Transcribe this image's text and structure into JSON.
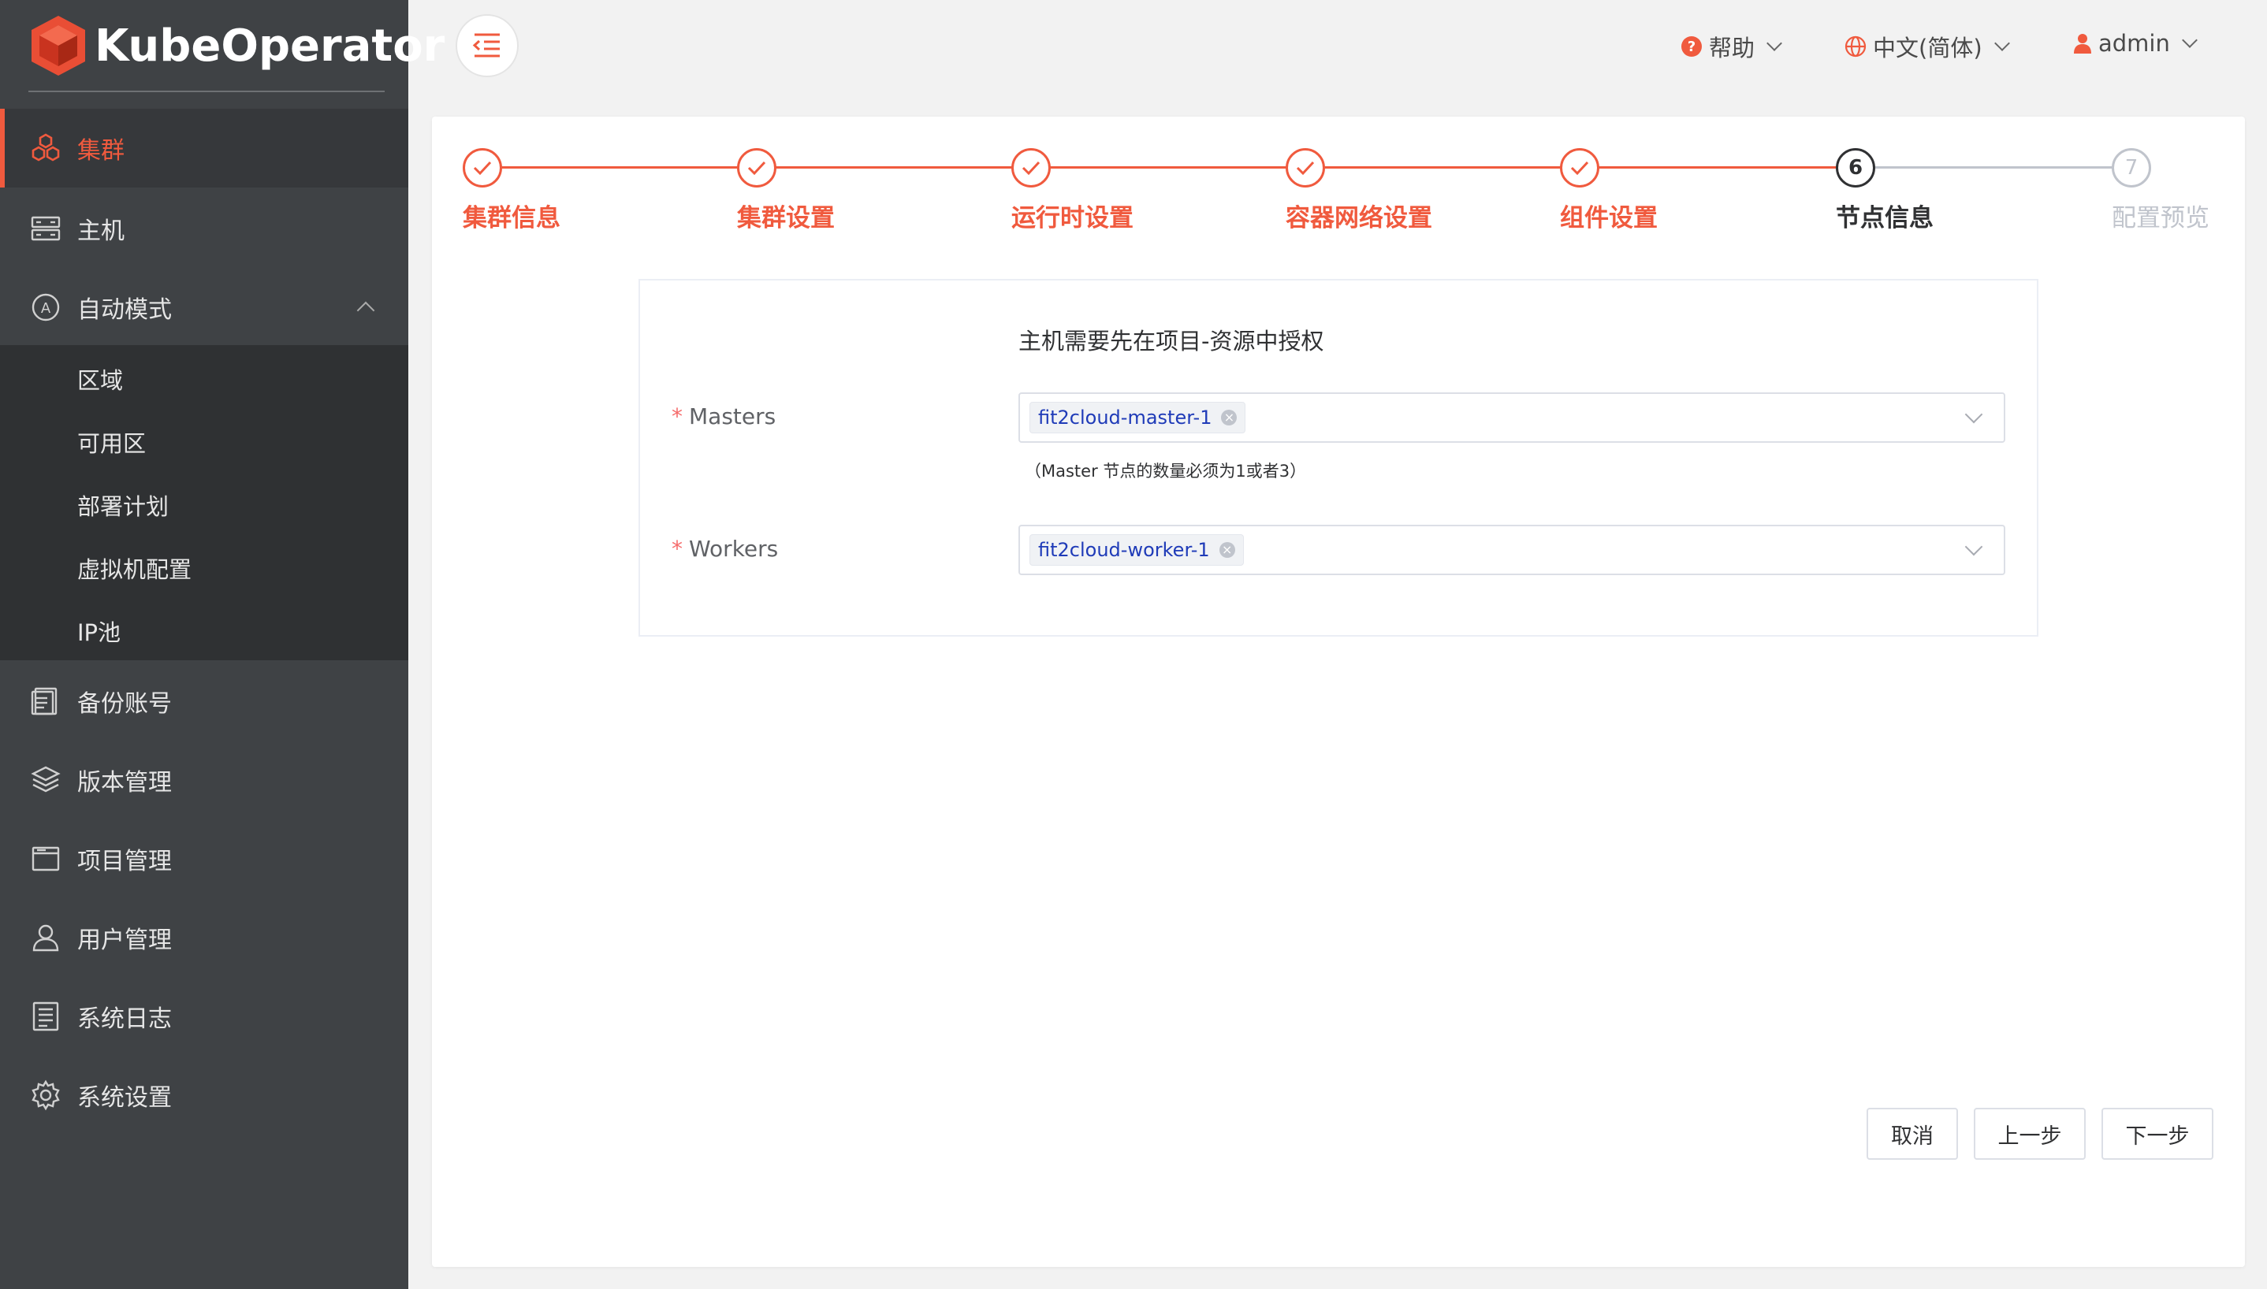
{
  "app": {
    "logo_text": "KubeOperator",
    "brand_color": "#f05a3e"
  },
  "sidebar": {
    "items": [
      {
        "label": "集群",
        "icon": "cluster-icon",
        "active": true
      },
      {
        "label": "主机",
        "icon": "server-icon"
      },
      {
        "label": "自动模式",
        "icon": "auto-mode-icon",
        "expanded": true
      },
      {
        "label": "备份账号",
        "icon": "backup-icon"
      },
      {
        "label": "版本管理",
        "icon": "layers-icon"
      },
      {
        "label": "项目管理",
        "icon": "folder-icon"
      },
      {
        "label": "用户管理",
        "icon": "user-icon"
      },
      {
        "label": "系统日志",
        "icon": "log-icon"
      },
      {
        "label": "系统设置",
        "icon": "gear-icon"
      }
    ],
    "submenu": [
      "区域",
      "可用区",
      "部署计划",
      "虚拟机配置",
      "IP池"
    ]
  },
  "header": {
    "help": "帮助",
    "language": "中文(简体)",
    "user": "admin"
  },
  "steps": [
    {
      "num": "1",
      "label": "集群信息",
      "status": "done"
    },
    {
      "num": "2",
      "label": "集群设置",
      "status": "done"
    },
    {
      "num": "3",
      "label": "运行时设置",
      "status": "done"
    },
    {
      "num": "4",
      "label": "容器网络设置",
      "status": "done"
    },
    {
      "num": "5",
      "label": "组件设置",
      "status": "done"
    },
    {
      "num": "6",
      "label": "节点信息",
      "status": "current"
    },
    {
      "num": "7",
      "label": "配置预览",
      "status": "wait"
    }
  ],
  "form": {
    "auth_note": "主机需要先在项目-资源中授权",
    "masters": {
      "label": "Masters",
      "selected": [
        "fit2cloud-master-1"
      ],
      "hint": "（Master 节点的数量必须为1或者3）"
    },
    "workers": {
      "label": "Workers",
      "selected": [
        "fit2cloud-worker-1"
      ]
    }
  },
  "buttons": {
    "cancel": "取消",
    "prev": "上一步",
    "next": "下一步"
  }
}
